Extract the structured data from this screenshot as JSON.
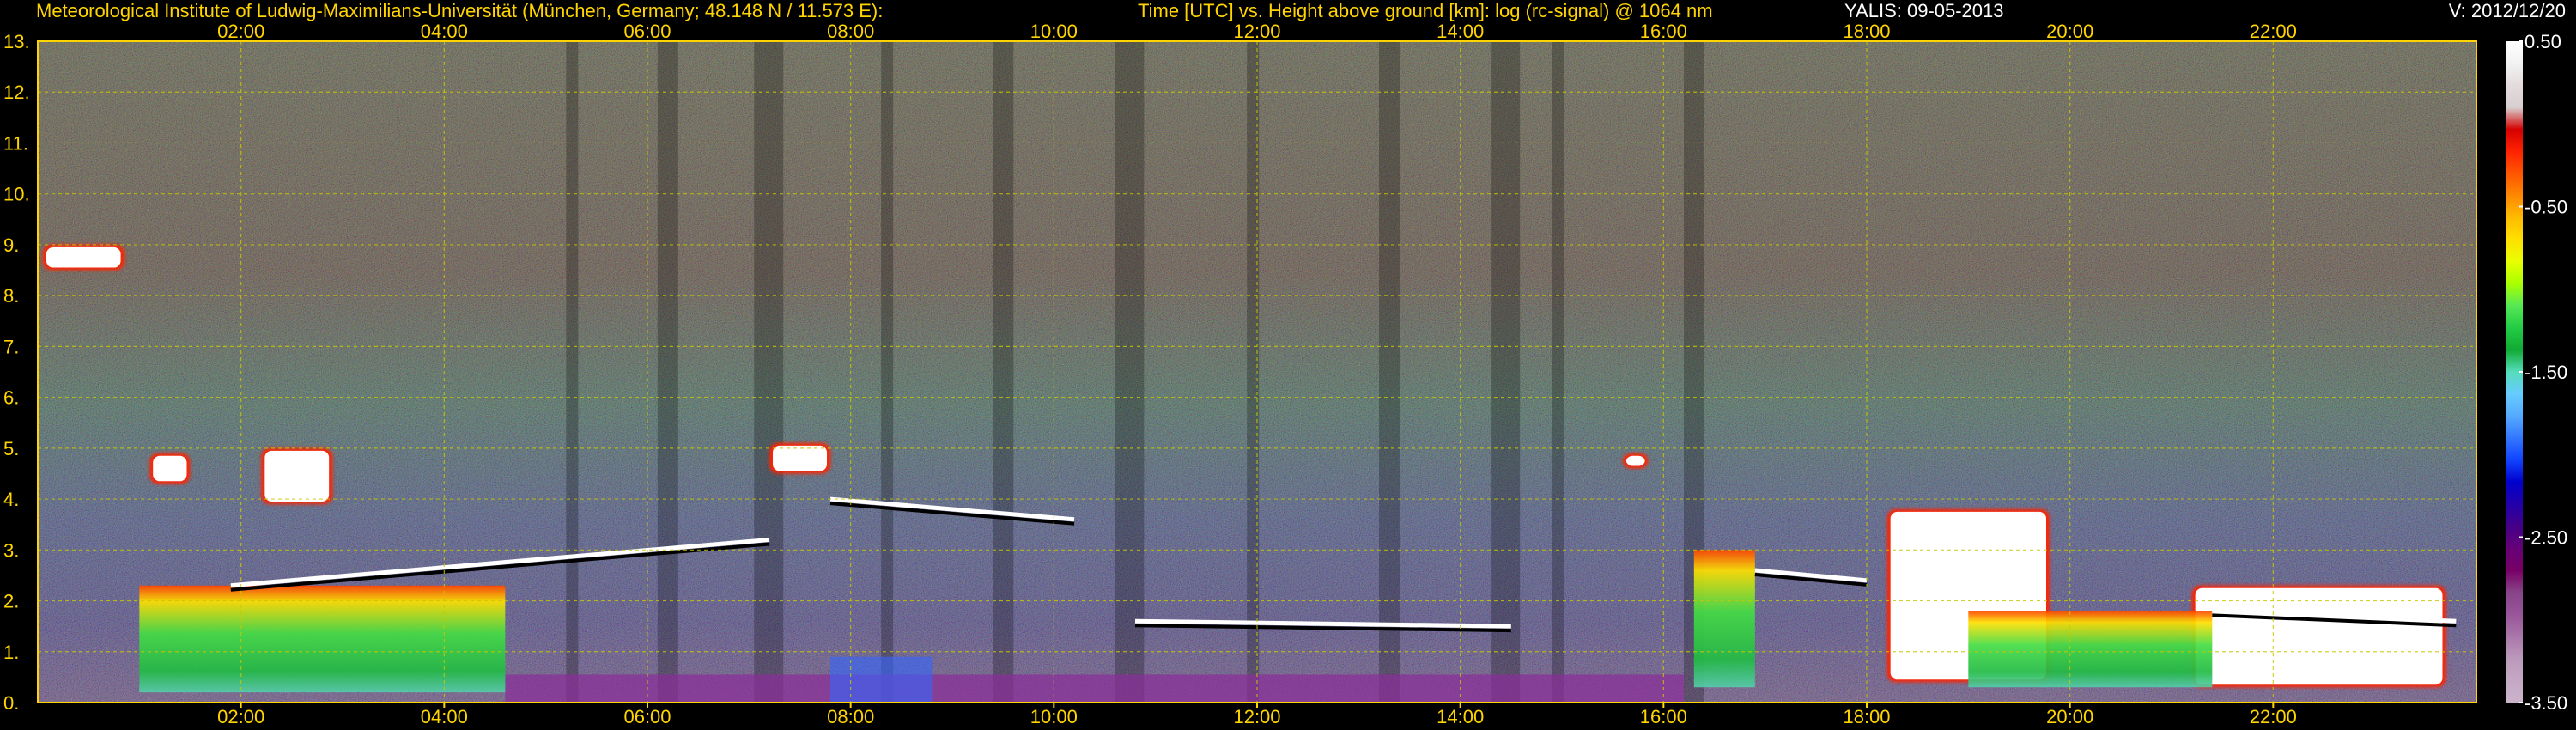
{
  "header": {
    "left": "Meteorological Institute of Ludwig-Maximilians-Universität (München, Germany; 48.148 N / 11.573 E):",
    "middle": "Time [UTC] vs. Height above ground [km]: log (rc-signal) @ 1064 nm",
    "station_date": "YALIS: 09-05-2013",
    "version": "V: 2012/12/20"
  },
  "colors": {
    "text": "#ffd400",
    "grid": "#c8c800",
    "frame": "#ffd400"
  },
  "chart_data": {
    "type": "heatmap",
    "instrument": "YALIS",
    "wavelength": "1064 nm",
    "x": {
      "unit": "hours UTC",
      "range": [
        0,
        24
      ],
      "ticks": [
        2,
        4,
        6,
        8,
        10,
        12,
        14,
        16,
        18,
        20,
        22
      ],
      "tick_labels": [
        "02:00",
        "04:00",
        "06:00",
        "08:00",
        "10:00",
        "12:00",
        "14:00",
        "16:00",
        "18:00",
        "20:00",
        "22:00"
      ]
    },
    "y": {
      "unit": "km",
      "range": [
        0,
        13
      ],
      "ticks": [
        0,
        1,
        2,
        3,
        4,
        5,
        6,
        7,
        8,
        9,
        10,
        11,
        12,
        13
      ],
      "tick_labels": [
        "0.",
        "1.",
        "2.",
        "3.",
        "4.",
        "5.",
        "6.",
        "7.",
        "8.",
        "9.",
        "10.",
        "11.",
        "12.",
        "13."
      ]
    },
    "grid": true,
    "colorbar": {
      "range": [
        -3.5,
        0.5
      ],
      "tick_values": [
        0.5,
        -0.5,
        -1.5,
        -2.5,
        -3.5
      ],
      "tick_labels": [
        "0.50",
        "-0.50",
        "-1.50",
        "-2.50",
        "-3.50"
      ],
      "colors_top_to_bottom": [
        "#ffffff",
        "#f2f2f2",
        "#e4dcdc",
        "#d8d0d0",
        "#d40000",
        "#ff2200",
        "#ff5500",
        "#ff8800",
        "#ffbb00",
        "#ffe000",
        "#e8ff00",
        "#aaff00",
        "#55e855",
        "#22cc44",
        "#11aa33",
        "#55ddbb",
        "#66ccff",
        "#55aaff",
        "#3377ff",
        "#1144ff",
        "#0000cc",
        "#2200aa",
        "#440088",
        "#660077",
        "#770066",
        "#884488",
        "#995599",
        "#aa77aa",
        "#bb99bb",
        "#c4a8c4",
        "#cbb4cb"
      ]
    },
    "features": [
      {
        "kind": "cloud",
        "t_start": 0.05,
        "t_end": 0.85,
        "z_bottom": 8.5,
        "z_top": 9.0
      },
      {
        "kind": "cloud",
        "t_start": 1.1,
        "t_end": 1.5,
        "z_bottom": 4.3,
        "z_top": 4.9
      },
      {
        "kind": "cloud",
        "t_start": 2.2,
        "t_end": 2.9,
        "z_bottom": 3.9,
        "z_top": 5.0
      },
      {
        "kind": "cloud",
        "t_start": 7.2,
        "t_end": 7.8,
        "z_bottom": 4.5,
        "z_top": 5.1
      },
      {
        "kind": "cloud",
        "t_start": 15.6,
        "t_end": 15.85,
        "z_bottom": 4.6,
        "z_top": 4.9
      },
      {
        "kind": "cloud",
        "t_start": 18.2,
        "t_end": 19.8,
        "z_bottom": 0.4,
        "z_top": 3.8
      },
      {
        "kind": "cloud",
        "t_start": 21.2,
        "t_end": 23.7,
        "z_bottom": 0.3,
        "z_top": 2.3
      },
      {
        "kind": "boundary_layer",
        "t_start": 1.0,
        "t_end": 4.6,
        "z_bottom": 0.2,
        "z_top": 2.3
      },
      {
        "kind": "boundary_layer",
        "t_start": 16.3,
        "t_end": 16.9,
        "z_bottom": 0.3,
        "z_top": 3.0
      },
      {
        "kind": "boundary_layer",
        "t_start": 19.0,
        "t_end": 21.4,
        "z_bottom": 0.3,
        "z_top": 1.8
      },
      {
        "kind": "layer_top",
        "t_start": 1.9,
        "t_end": 7.2,
        "z_start": 2.3,
        "z_end": 3.2
      },
      {
        "kind": "layer_top",
        "t_start": 7.8,
        "t_end": 10.2,
        "z_start": 4.0,
        "z_end": 3.6
      },
      {
        "kind": "layer_top",
        "t_start": 10.8,
        "t_end": 14.5,
        "z_start": 1.6,
        "z_end": 1.5
      },
      {
        "kind": "layer_top",
        "t_start": 16.9,
        "t_end": 18.0,
        "z_start": 2.6,
        "z_end": 2.4
      },
      {
        "kind": "layer_top",
        "t_start": 21.4,
        "t_end": 23.8,
        "z_start": 1.8,
        "z_end": 1.6
      }
    ]
  }
}
